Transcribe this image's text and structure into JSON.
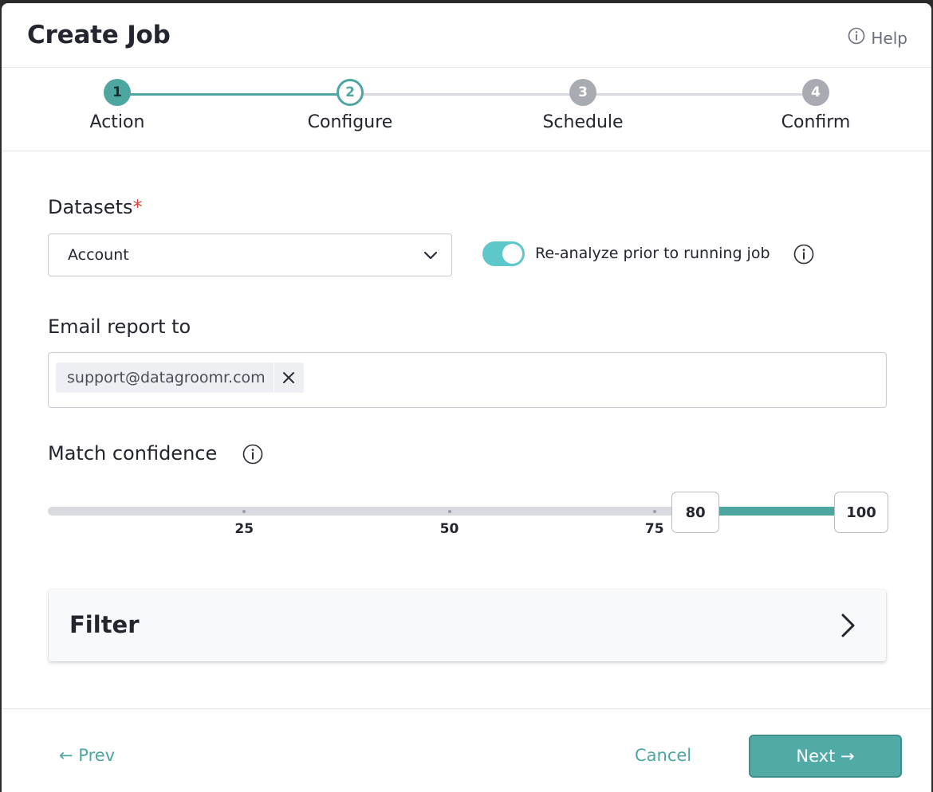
{
  "header": {
    "title": "Create Job",
    "help_label": "Help"
  },
  "stepper": {
    "steps": [
      {
        "number": "1",
        "label": "Action",
        "state": "done"
      },
      {
        "number": "2",
        "label": "Configure",
        "state": "active"
      },
      {
        "number": "3",
        "label": "Schedule",
        "state": "pending"
      },
      {
        "number": "4",
        "label": "Confirm",
        "state": "pending"
      }
    ]
  },
  "datasets": {
    "label": "Datasets",
    "required_mark": "*",
    "selected": "Account"
  },
  "reanalyze": {
    "label": "Re-analyze prior to running job",
    "enabled": true
  },
  "email": {
    "label": "Email report to",
    "recipients": [
      "support@datagroomr.com"
    ]
  },
  "match_confidence": {
    "label": "Match confidence",
    "min": 0,
    "max": 100,
    "ticks": [
      "25",
      "50",
      "75"
    ],
    "low_value": "80",
    "high_value": "100"
  },
  "filter": {
    "title": "Filter"
  },
  "footer": {
    "prev_label": "← Prev",
    "cancel_label": "Cancel",
    "next_label": "Next →"
  },
  "colors": {
    "accent": "#4ea6a0",
    "toggle_on": "#5ec7c9",
    "required": "#e0433a"
  }
}
